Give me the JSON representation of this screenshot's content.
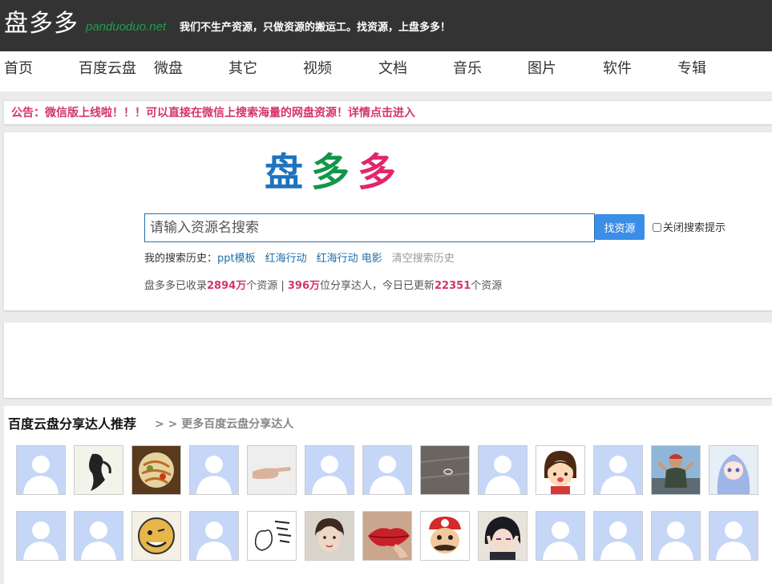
{
  "header": {
    "logo": "盘多多",
    "domain": "panduoduo.net",
    "slogan": "我们不生产资源，只做资源的搬运工。找资源，上盘多多！"
  },
  "nav": {
    "items": [
      "首页",
      "百度云盘",
      "微盘",
      "其它",
      "视频",
      "文档",
      "音乐",
      "图片",
      "软件",
      "专辑"
    ]
  },
  "notice": {
    "text": "公告：微信版上线啦！！！可以直接在微信上搜索海量的网盘资源！详情点击进入"
  },
  "search": {
    "logo_chars": [
      "盘",
      "多",
      "多"
    ],
    "logo_colors": [
      "#1e73be",
      "#12964a",
      "#e2266b"
    ],
    "placeholder": "请输入资源名搜索",
    "button_label": "找资源",
    "hint_toggle_label": "关闭搜索提示",
    "history_label": "我的搜索历史：",
    "history_items": [
      "ppt模板",
      "红海行动",
      "红海行动 电影"
    ],
    "clear_history_label": "清空搜索历史"
  },
  "stats": {
    "prefix": "盘多多已收录",
    "resources_count": "2894万",
    "mid1": "个资源 | ",
    "sharers_count": "396万",
    "mid2": "位分享达人，今日已更新",
    "today_count": "22351",
    "suffix": "个资源"
  },
  "sharers": {
    "title": "百度云盘分享达人推荐",
    "more_label": "> > 更多百度云盘分享达人",
    "avatars": [
      {
        "type": "default-avatar-icon"
      },
      {
        "type": "ink-figure-avatar-icon"
      },
      {
        "type": "food-avatar-icon"
      },
      {
        "type": "default-avatar-icon"
      },
      {
        "type": "hand-avatar-icon"
      },
      {
        "type": "default-avatar-icon"
      },
      {
        "type": "default-avatar-icon"
      },
      {
        "type": "ring-avatar-icon"
      },
      {
        "type": "default-avatar-icon"
      },
      {
        "type": "cartoon-girl-avatar-icon"
      },
      {
        "type": "default-avatar-icon"
      },
      {
        "type": "person-avatar-icon"
      },
      {
        "type": "anime-girl-avatar-icon"
      },
      {
        "type": "default-avatar-icon"
      },
      {
        "type": "default-avatar-icon"
      },
      {
        "type": "smiley-avatar-icon"
      },
      {
        "type": "default-avatar-icon"
      },
      {
        "type": "doodle-avatar-icon"
      },
      {
        "type": "boy-photo-avatar-icon"
      },
      {
        "type": "lips-avatar-icon"
      },
      {
        "type": "mario-avatar-icon"
      },
      {
        "type": "anime-boy-avatar-icon"
      },
      {
        "type": "default-avatar-icon"
      },
      {
        "type": "default-avatar-icon"
      },
      {
        "type": "default-avatar-icon"
      },
      {
        "type": "default-avatar-icon"
      }
    ]
  },
  "colors": {
    "header_bg": "#333333",
    "domain": "#1f9e4a",
    "accent_red": "#d6336c",
    "link_blue": "#1f6fa8",
    "button_blue": "#3b8ee8",
    "avatar_bg": "#c5d6f7"
  }
}
